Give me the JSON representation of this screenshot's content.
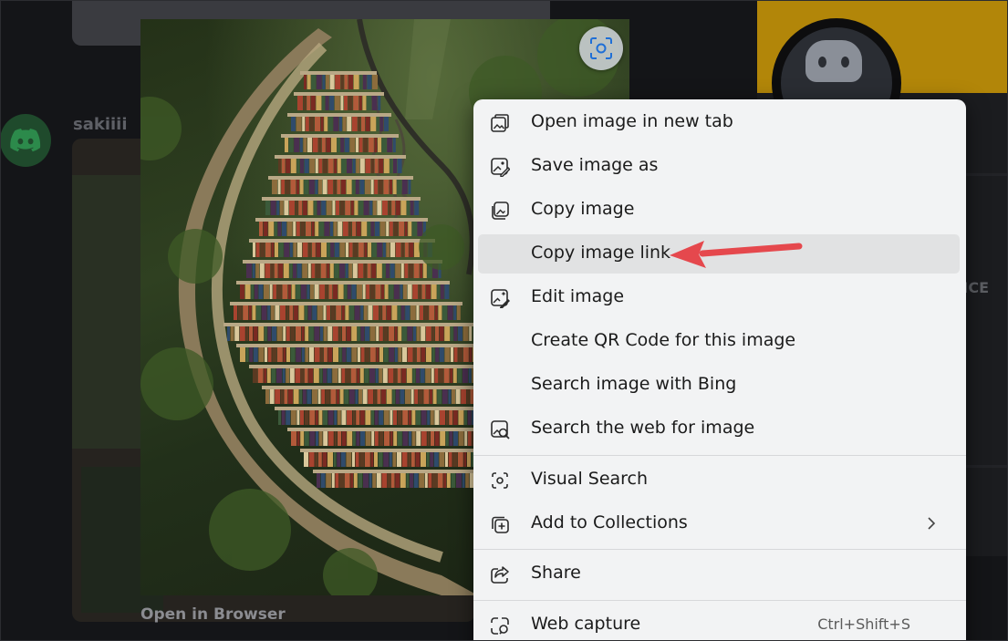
{
  "background": {
    "username": "sakiiii",
    "right_panel_partial_text": "NCE"
  },
  "image_viewer": {
    "open_in_browser_label": "Open in Browser",
    "visual_search_icon": "visual-search-icon"
  },
  "context_menu": {
    "items": [
      {
        "label": "Open image in new tab",
        "icon": "open-new-tab-icon"
      },
      {
        "label": "Save image as",
        "icon": "save-image-icon"
      },
      {
        "label": "Copy image",
        "icon": "copy-image-icon"
      },
      {
        "label": "Copy image link",
        "icon": ""
      },
      {
        "label": "Edit image",
        "icon": "edit-image-icon"
      },
      {
        "label": "Create QR Code for this image",
        "icon": ""
      },
      {
        "label": "Search image with Bing",
        "icon": ""
      },
      {
        "label": "Search the web for image",
        "icon": "search-web-image-icon"
      },
      {
        "label": "Visual Search",
        "icon": "visual-search-icon"
      },
      {
        "label": "Add to Collections",
        "icon": "add-to-collections-icon"
      },
      {
        "label": "Share",
        "icon": "share-icon"
      },
      {
        "label": "Web capture",
        "icon": "web-capture-icon",
        "shortcut": "Ctrl+Shift+S"
      }
    ],
    "highlighted_item": "Copy image link"
  },
  "colors": {
    "menu_background": "#f2f3f4",
    "menu_highlight": "#e1e2e3",
    "annotation_arrow": "#e5484d",
    "discord_green": "#1f4a2c",
    "banner_yellow": "#b28609"
  }
}
